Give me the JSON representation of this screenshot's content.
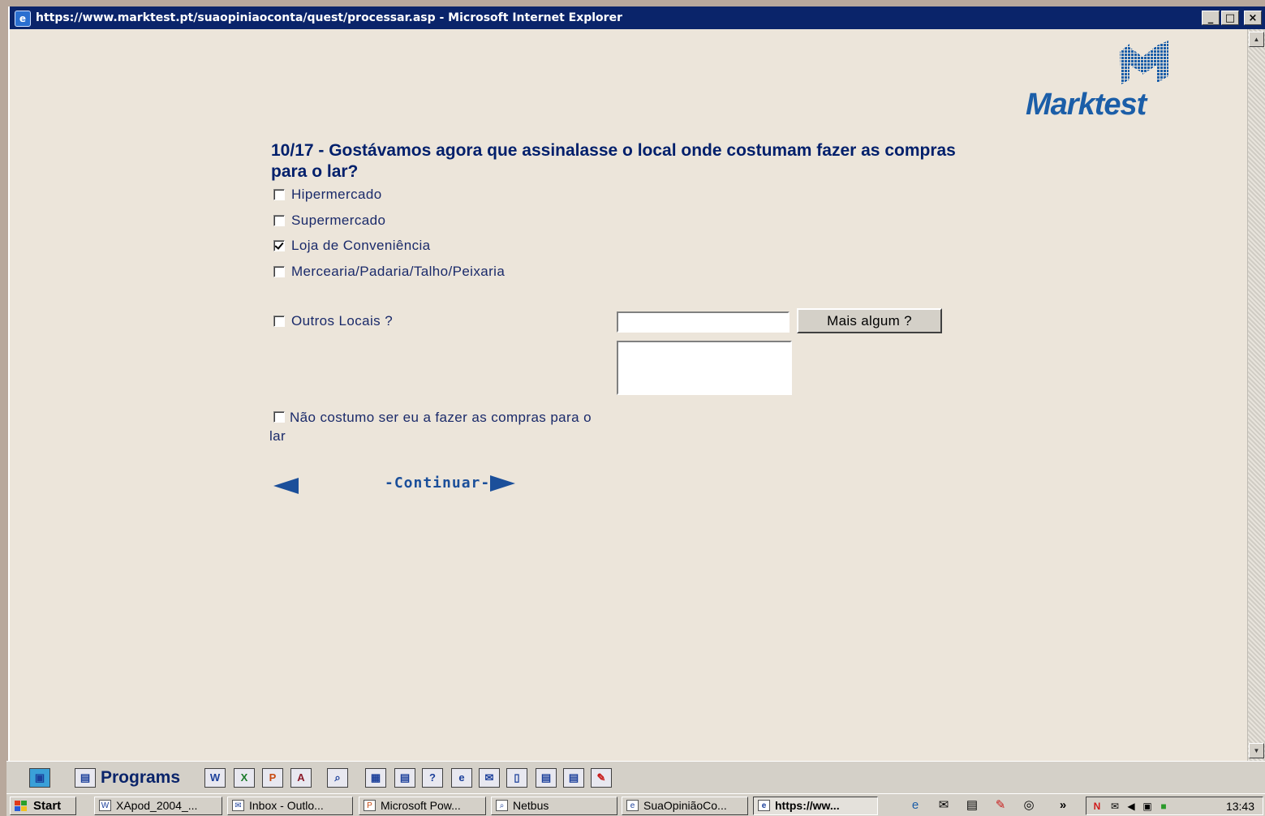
{
  "window": {
    "title": "https://www.marktest.pt/suaopiniaoconta/quest/processar.asp - Microsoft Internet Explorer",
    "controls": {
      "minimize": "_",
      "maximize": "□",
      "close": "×"
    }
  },
  "logo": {
    "text": "Marktest",
    "color": "#1b5ea8"
  },
  "question": {
    "text": "10/17 - Gostávamos agora que assinalasse o local onde costumam fazer as compras para o lar?",
    "options": [
      {
        "label": "Hipermercado",
        "checked": false
      },
      {
        "label": "Supermercado",
        "checked": false
      },
      {
        "label": "Loja de Conveniência",
        "checked": true
      },
      {
        "label": "Mercearia/Padaria/Talho/Peixaria",
        "checked": false
      }
    ],
    "outros": {
      "label": "Outros Locais ?",
      "checked": false,
      "input_value": "",
      "button_label": "Mais algum ?"
    },
    "nao_costumo": {
      "label": "Não costumo ser eu a fazer as compras para o lar",
      "checked": false
    }
  },
  "nav": {
    "continue_label": "-Continuar-"
  },
  "quickbar": {
    "programs_label": "Programs"
  },
  "taskbar": {
    "start_label": "Start",
    "tasks": [
      {
        "label": "XApod_2004_...",
        "icon": "word-icon"
      },
      {
        "label": "Inbox - Outlo...",
        "icon": "outlook-icon"
      },
      {
        "label": "Microsoft Pow...",
        "icon": "powerpoint-icon"
      },
      {
        "label": "Netbus",
        "icon": "netbus-icon"
      },
      {
        "label": "SuaOpiniãoCo...",
        "icon": "ie-icon"
      },
      {
        "label": "https://ww...",
        "icon": "ie-icon",
        "active": true
      }
    ],
    "clock": "13:43"
  }
}
